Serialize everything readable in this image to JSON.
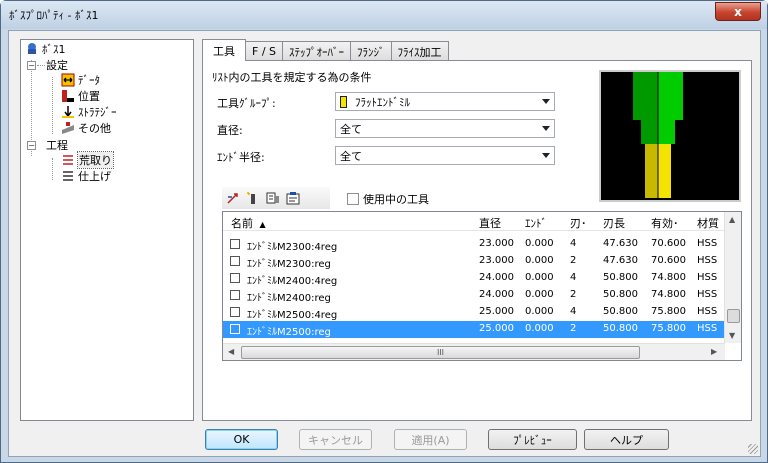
{
  "window": {
    "title": "ﾎﾞｽﾌﾟﾛﾊﾟﾃｨ - ﾎﾞｽ1",
    "close_label": "x"
  },
  "tree": {
    "root": "ﾎﾞｽ1",
    "settings": "設定",
    "settings_items": [
      "ﾃﾞｰﾀ",
      "位置",
      "ｽﾄﾗﾃｼﾞｰ",
      "その他"
    ],
    "process": "工程",
    "process_items": [
      "荒取り",
      "仕上げ"
    ]
  },
  "tabs": [
    "工具",
    "F / S",
    "ｽﾃｯﾌﾟｵｰﾊﾞｰ",
    "ﾌﾗﾝｼﾞ",
    "ﾌﾗｲｽ加工"
  ],
  "tool_panel": {
    "caption": "ﾘｽﾄ内の工具を規定する為の条件",
    "group_label": "工具ｸﾞﾙｰﾌﾟ:",
    "group_value": "ﾌﾗｯﾄｴﾝﾄﾞﾐﾙ",
    "group_color": "#f4e200",
    "diameter_label": "直径:",
    "diameter_value": "全て",
    "end_radius_label": "ｴﾝﾄﾞ半径:",
    "end_radius_value": "全て",
    "in_use_label": "使用中の工具",
    "toolbar_icons": [
      "pick-tool-icon",
      "new-tool-icon",
      "tool-library-icon",
      "tool-properties-icon"
    ]
  },
  "list": {
    "headers": [
      "名前",
      "直径",
      "ｴﾝﾄﾞ",
      "刃･",
      "刃長",
      "有効･",
      "材質"
    ],
    "sort_indicator": "▲",
    "rows": [
      [
        "ｴﾝﾄﾞﾐﾙM2300:4reg",
        "23.000",
        "0.000",
        "4",
        "47.630",
        "70.600",
        "HSS"
      ],
      [
        "ｴﾝﾄﾞﾐﾙM2300:reg",
        "23.000",
        "0.000",
        "2",
        "47.630",
        "70.600",
        "HSS"
      ],
      [
        "ｴﾝﾄﾞﾐﾙM2400:4reg",
        "24.000",
        "0.000",
        "4",
        "50.800",
        "74.800",
        "HSS"
      ],
      [
        "ｴﾝﾄﾞﾐﾙM2400:reg",
        "24.000",
        "0.000",
        "2",
        "50.800",
        "74.800",
        "HSS"
      ],
      [
        "ｴﾝﾄﾞﾐﾙM2500:4reg",
        "25.000",
        "0.000",
        "4",
        "50.800",
        "75.800",
        "HSS"
      ],
      [
        "ｴﾝﾄﾞﾐﾙM2500:reg",
        "25.000",
        "0.000",
        "2",
        "50.800",
        "75.800",
        "HSS"
      ]
    ],
    "selected_row": 5,
    "hscroll_thumb": "III"
  },
  "buttons": {
    "ok": "OK",
    "cancel": "キャンセル",
    "apply": "適用(A)",
    "preview": "ﾌﾟﾚﾋﾞｭｰ",
    "help": "ヘルプ"
  },
  "colors": {
    "tool_shank": "#00cc00",
    "tool_flute": "#f4e200",
    "selection": "#3399ff"
  }
}
